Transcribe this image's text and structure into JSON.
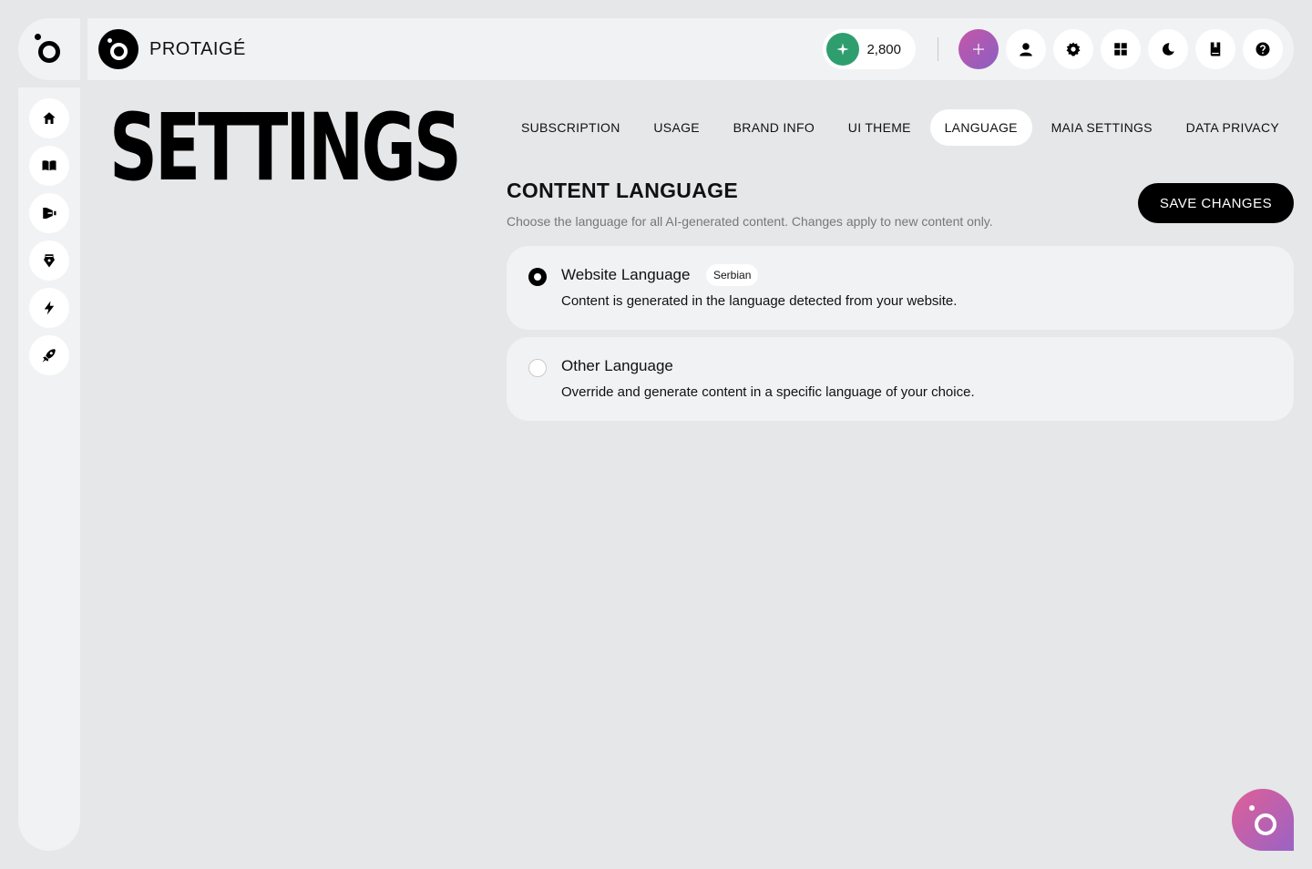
{
  "brand": {
    "name": "PROTAIGÉ"
  },
  "header": {
    "credits": "2,800",
    "actions": [
      "plus-icon",
      "user-icon",
      "gear-icon",
      "grid-icon",
      "moon-icon",
      "book-icon",
      "help-icon"
    ]
  },
  "sidebar": {
    "items": [
      "home-icon",
      "book-open-icon",
      "megaphone-icon",
      "pen-nib-icon",
      "lightning-icon",
      "rocket-icon"
    ]
  },
  "page": {
    "title": "SETTINGS"
  },
  "tabs": [
    {
      "label": "SUBSCRIPTION"
    },
    {
      "label": "USAGE"
    },
    {
      "label": "BRAND INFO"
    },
    {
      "label": "UI THEME"
    },
    {
      "label": "LANGUAGE",
      "active": true
    },
    {
      "label": "MAIA SETTINGS"
    },
    {
      "label": "DATA PRIVACY"
    }
  ],
  "section": {
    "title": "CONTENT LANGUAGE",
    "description": "Choose the language for all AI-generated content. Changes apply to new content only.",
    "save_label": "SAVE CHANGES"
  },
  "options": [
    {
      "title": "Website Language",
      "badge": "Serbian",
      "description": "Content is generated in the language detected from your website.",
      "selected": true
    },
    {
      "title": "Other Language",
      "description": "Override and generate content in a specific language of your choice.",
      "selected": false
    }
  ],
  "colors": {
    "accent_green": "#2f9e6e",
    "accent_pink": "#c556a8",
    "accent_purple": "#8a5fc2"
  }
}
